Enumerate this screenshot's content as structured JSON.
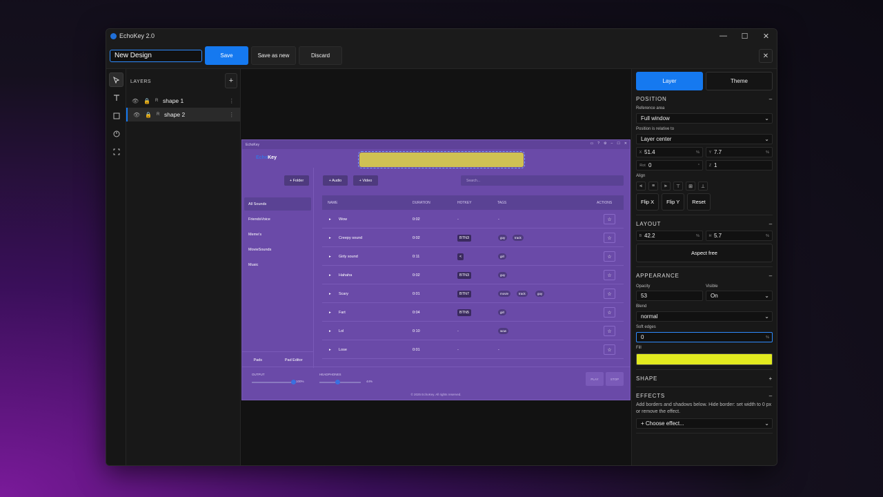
{
  "window": {
    "title": "EchoKey 2.0",
    "minimize": "—",
    "maximize": "☐",
    "close": "✕"
  },
  "toolbar": {
    "design_name": "New Design",
    "save": "Save",
    "save_as_new": "Save as new",
    "discard": "Discard",
    "close": "✕"
  },
  "tools": [
    "select-tool",
    "text-tool",
    "rect-tool",
    "circle-tool",
    "frame-tool"
  ],
  "layers": {
    "title": "LAYERS",
    "add": "+",
    "items": [
      {
        "name": "shape 1",
        "kind": "R",
        "selected": false
      },
      {
        "name": "shape 2",
        "kind": "R",
        "selected": true
      }
    ]
  },
  "preview": {
    "title": "EchoKey",
    "logo_a": "Echo",
    "logo_b": "Key",
    "folder": "+ Folder",
    "audio": "+ Audio",
    "video": "+ Video",
    "search": "Search...",
    "categories": [
      "All Sounds",
      "FriendsVoice",
      "Meme's",
      "MovieSounds",
      "Music"
    ],
    "pads": "Pads",
    "pad_editor": "Pad Editor",
    "columns": {
      "name": "NAME",
      "duration": "DURATION",
      "hotkey": "HOTKEY",
      "tags": "TAGS",
      "actions": "ACTIONS"
    },
    "rows": [
      {
        "name": "Wow",
        "duration": "0:02",
        "hotkey": "-",
        "tags": [
          "-"
        ]
      },
      {
        "name": "Creepy sound",
        "duration": "0:02",
        "hotkey": "BTN3",
        "tags": [
          "guy",
          "track"
        ]
      },
      {
        "name": "Girly sound",
        "duration": "0:11",
        "hotkey": "<",
        "tags": [
          "girl"
        ]
      },
      {
        "name": "Hahaha",
        "duration": "0:02",
        "hotkey": "BTN3",
        "tags": [
          "guy"
        ]
      },
      {
        "name": "Scary",
        "duration": "0:01",
        "hotkey": "BTN7",
        "tags": [
          "movie",
          "track",
          "guy"
        ]
      },
      {
        "name": "Fart",
        "duration": "0:04",
        "hotkey": "BTN5",
        "tags": [
          "girl"
        ]
      },
      {
        "name": "Lol",
        "duration": "0:10",
        "hotkey": "-",
        "tags": [
          "wow"
        ]
      },
      {
        "name": "Lose",
        "duration": "0:01",
        "hotkey": "-",
        "tags": [
          "-"
        ]
      }
    ],
    "output_label": "OUTPUT",
    "output_pct": "100%",
    "headphones_label": "HEADPHONES",
    "headphones_pct": "44%",
    "output_level": 1.0,
    "headphones_level": 0.44,
    "play": "PLAY",
    "stop": "STOP",
    "copyright": "© 2025 EchoKey. All rights reserved."
  },
  "props": {
    "tab_layer": "Layer",
    "tab_theme": "Theme",
    "position": {
      "title": "POSITION",
      "collapse": "–",
      "ref_label": "Reference area",
      "ref_value": "Full window",
      "rel_label": "Position is relative to",
      "rel_value": "Layer center",
      "x": "51.4",
      "y": "7.7",
      "rot": "0",
      "z": "1",
      "align_label": "Align",
      "flip_x": "Flip X",
      "flip_y": "Flip Y",
      "reset": "Reset"
    },
    "layout": {
      "title": "LAYOUT",
      "collapse": "–",
      "b": "42.2",
      "h": "5.7",
      "aspect": "Aspect free"
    },
    "appearance": {
      "title": "APPEARANCE",
      "collapse": "–",
      "opacity_label": "Opacity",
      "opacity": "53",
      "visible_label": "Visible",
      "visible": "On",
      "blend_label": "Blend",
      "blend": "normal",
      "soft_label": "Soft edges",
      "soft": "0",
      "fill_label": "Fill",
      "fill_color": "#e2ea1f"
    },
    "shape": {
      "title": "SHAPE",
      "expand": "+"
    },
    "effects": {
      "title": "EFFECTS",
      "collapse": "–",
      "note": "Add borders and shadows below. Hide border: set width to 0 px or remove the effect.",
      "choose": "+ Choose effect..."
    }
  },
  "colors": {
    "accent": "#1579f0",
    "preview_bg": "#6a4aa8"
  }
}
